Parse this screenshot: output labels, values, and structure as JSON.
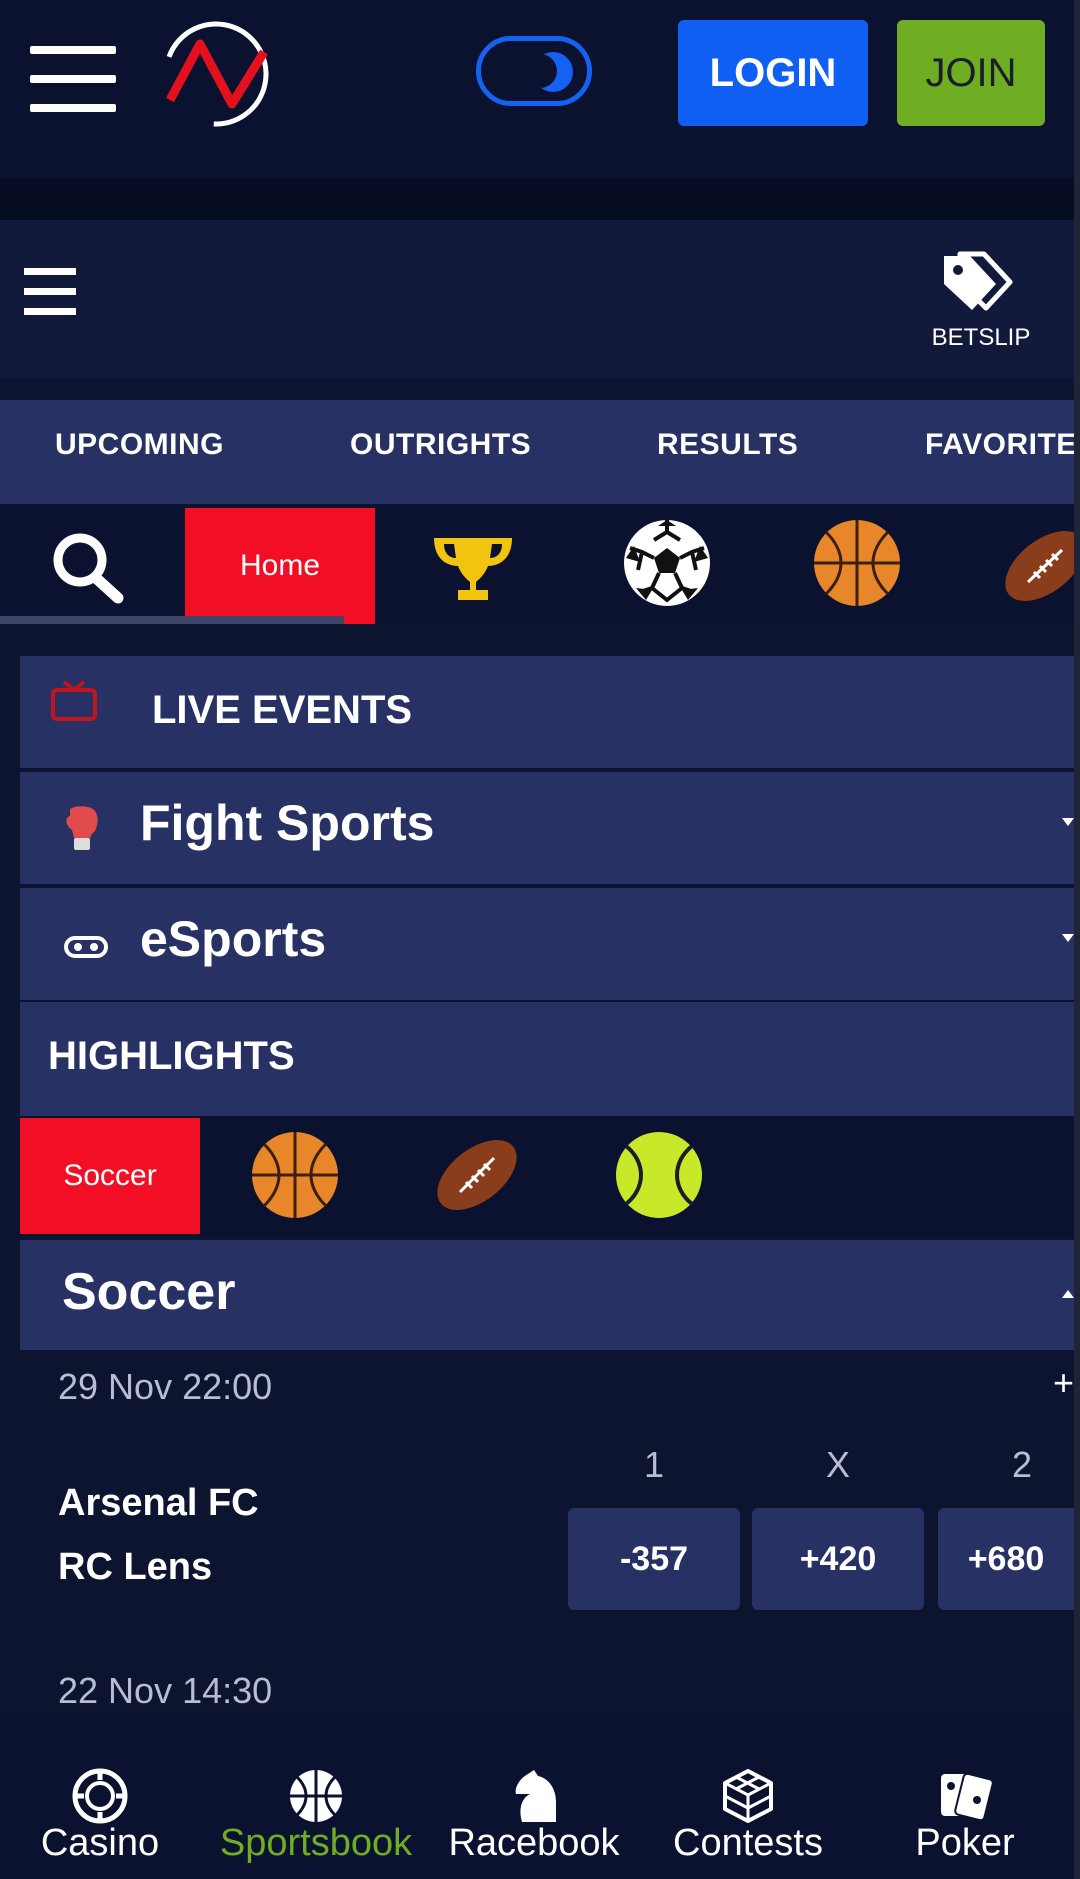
{
  "header": {
    "login_label": "LOGIN",
    "join_label": "JOIN",
    "theme": "dark-mode"
  },
  "subheader": {
    "betslip_label": "BETSLIP"
  },
  "tabs": [
    "UPCOMING",
    "OUTRIGHTS",
    "RESULTS",
    "FAVORITE"
  ],
  "sports_row": {
    "home_label": "Home",
    "icons": [
      "search-icon",
      "trophy-icon",
      "soccer-ball-icon",
      "basketball-icon",
      "american-football-icon"
    ]
  },
  "live_events": {
    "label": "LIVE EVENTS"
  },
  "categories": [
    {
      "label": "Fight Sports",
      "icon": "boxing-glove-icon"
    },
    {
      "label": "eSports",
      "icon": "gamepad-icon"
    }
  ],
  "highlights": {
    "label": "HIGHLIGHTS",
    "active_label": "Soccer",
    "icons": [
      "basketball-icon",
      "american-football-icon",
      "tennis-ball-icon"
    ]
  },
  "soccer": {
    "title": "Soccer",
    "match": {
      "date": "29 Nov 22:00",
      "more": "+",
      "headers": [
        "1",
        "X",
        "2"
      ],
      "home": "Arsenal FC",
      "away": "RC Lens",
      "odds": [
        "-357",
        "+420",
        "+680"
      ]
    },
    "next_date": "22 Nov 14:30"
  },
  "bottom_nav": [
    {
      "label": "Casino",
      "icon": "casino-chip-icon",
      "active": false
    },
    {
      "label": "Sportsbook",
      "icon": "basketball-icon",
      "active": true
    },
    {
      "label": "Racebook",
      "icon": "horse-icon",
      "active": false
    },
    {
      "label": "Contests",
      "icon": "cube-icon",
      "active": false
    },
    {
      "label": "Poker",
      "icon": "cards-icon",
      "active": false
    }
  ],
  "colors": {
    "accent_red": "#f20f25",
    "login_blue": "#0f5ff2",
    "join_green": "#6fae23",
    "panel": "#273163",
    "background": "#0b1230"
  }
}
